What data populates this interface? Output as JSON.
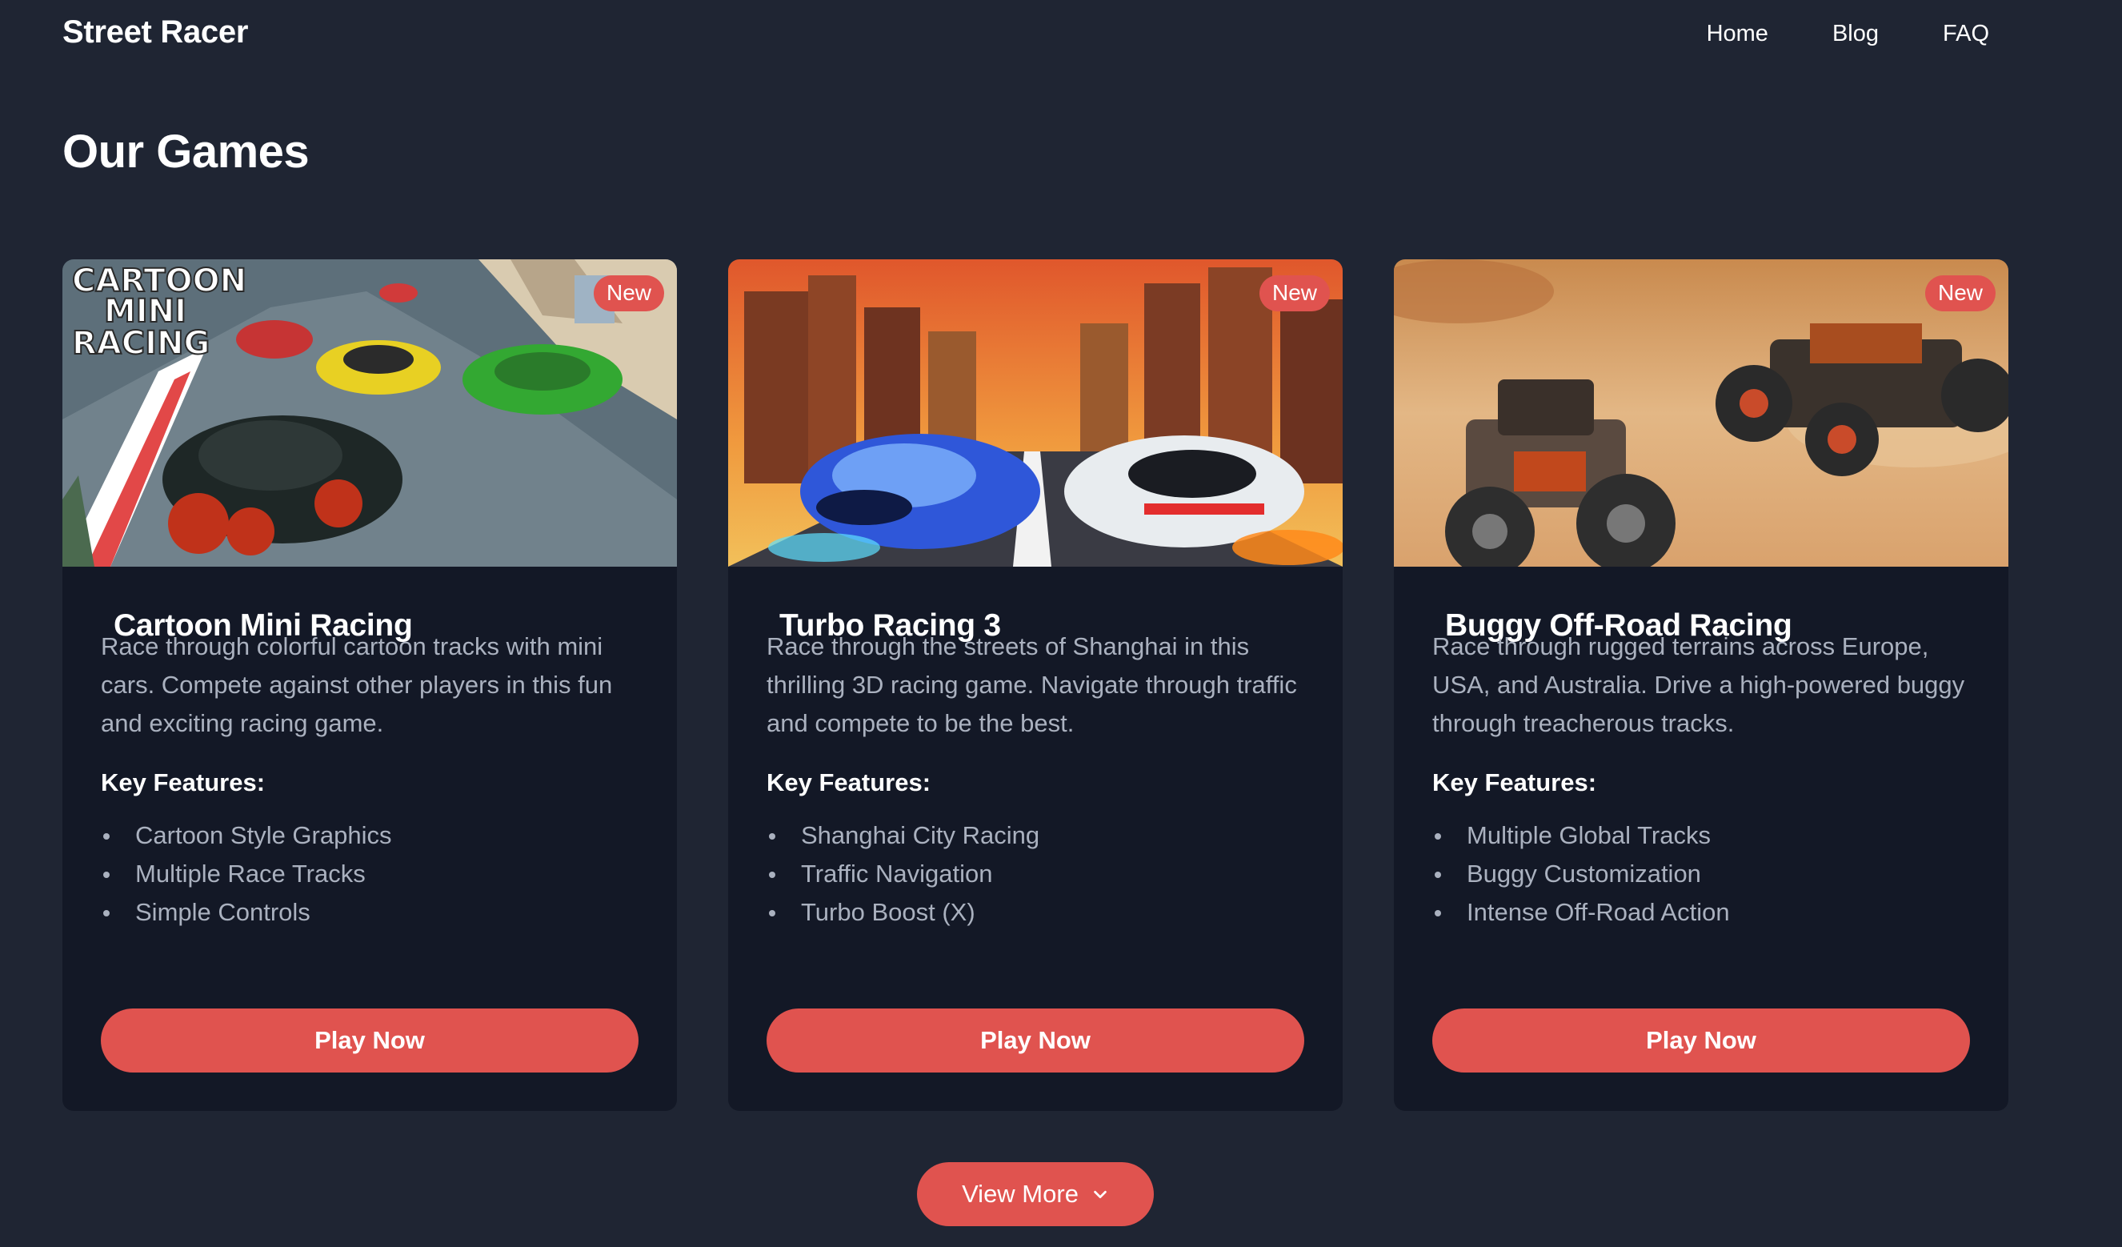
{
  "header": {
    "brand": "Street Racer",
    "nav": [
      "Home",
      "Blog",
      "FAQ"
    ]
  },
  "page_title": "Our Games",
  "games": [
    {
      "title": "Cartoon Mini Racing",
      "badge": "New",
      "description": "Race through colorful cartoon tracks with mini cars. Compete against other players in this fun and exciting racing game.",
      "features_label": "Key Features:",
      "features": [
        "Cartoon Style Graphics",
        "Multiple Race Tracks",
        "Simple Controls"
      ],
      "button": "Play Now",
      "thumb_logo_text": "CARTOON MINI RACING"
    },
    {
      "title": "Turbo Racing 3",
      "badge": "New",
      "description": "Race through the streets of Shanghai in this thrilling 3D racing game. Navigate through traffic and compete to be the best.",
      "features_label": "Key Features:",
      "features": [
        "Shanghai City Racing",
        "Traffic Navigation",
        "Turbo Boost (X)"
      ],
      "button": "Play Now"
    },
    {
      "title": "Buggy Off-Road Racing",
      "badge": "New",
      "description": "Race through rugged terrains across Europe, USA, and Australia. Drive a high-powered buggy through treacherous tracks.",
      "features_label": "Key Features:",
      "features": [
        "Multiple Global Tracks",
        "Buggy Customization",
        "Intense Off-Road Action"
      ],
      "button": "Play Now"
    }
  ],
  "view_more": {
    "label": "View More",
    "icon": "chevron-down-icon"
  },
  "colors": {
    "background": "#1f2533",
    "card": "#131826",
    "accent": "#e0534f",
    "muted_text": "#aab1bf"
  }
}
